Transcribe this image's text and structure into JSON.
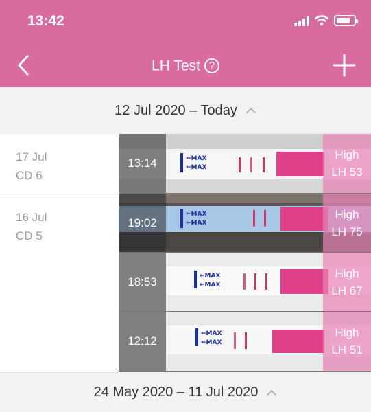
{
  "status": {
    "time": "13:42"
  },
  "nav": {
    "title": "LH Test",
    "help": "?"
  },
  "ranges": [
    {
      "label": "12 Jul 2020 – Today"
    },
    {
      "label": "24 May 2020 – 11 Jul 2020"
    }
  ],
  "days": [
    {
      "date": "17 Jul",
      "cycle_day": "CD 6"
    },
    {
      "date": "16 Jul",
      "cycle_day": "CD 5"
    }
  ],
  "tests": [
    {
      "time": "13:14",
      "level": "High",
      "value": "LH 53"
    },
    {
      "time": "19:02",
      "level": "High",
      "value": "LH 75"
    },
    {
      "time": "18:53",
      "level": "High",
      "value": "LH 67"
    },
    {
      "time": "12:12",
      "level": "High",
      "value": "LH 51"
    }
  ],
  "strip_text": "MAX",
  "colors": {
    "header": "#d86ca1",
    "accent_pink": "#e0408a",
    "strip_blue": "#1a2ea8"
  }
}
